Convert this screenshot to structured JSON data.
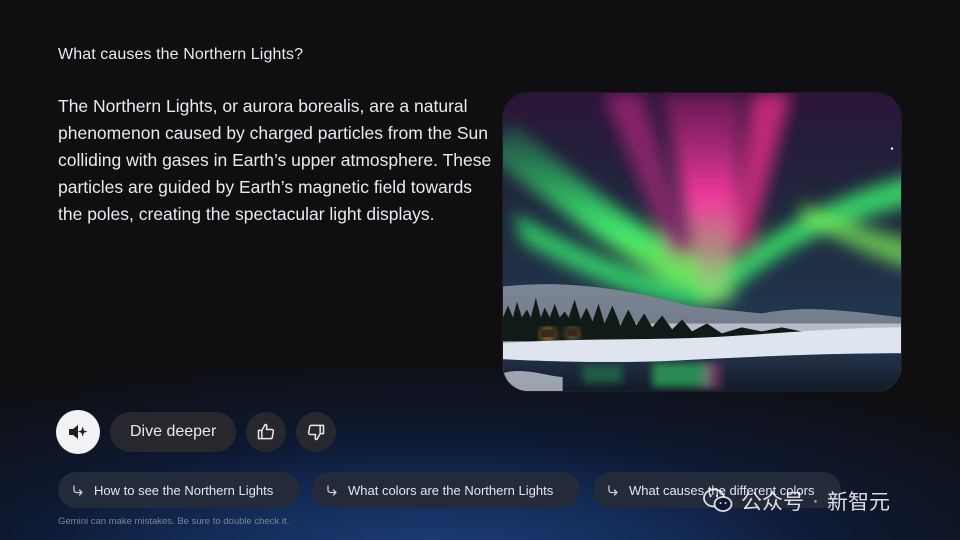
{
  "question": "What causes the Northern Lights?",
  "answer": "The Northern Lights, or aurora borealis, are a natural phenomenon caused by charged particles from the Sun colliding with gases in Earth’s upper atmosphere. These particles are guided by Earth’s magnetic field towards the poles, creating the spectacular light displays.",
  "image": {
    "subject": "aurora borealis over snowy forest and lake"
  },
  "actions": {
    "speak_icon": "speaker-sparkle-icon",
    "dive_deeper": "Dive deeper",
    "thumbs_up_icon": "thumbs-up-icon",
    "thumbs_down_icon": "thumbs-down-icon"
  },
  "suggestions": [
    {
      "icon": "reply-arrow-icon",
      "label": "How to see the Northern Lights"
    },
    {
      "icon": "reply-arrow-icon",
      "label": "What colors are the Northern Lights"
    },
    {
      "icon": "reply-arrow-icon",
      "label": "What causes the different colors"
    }
  ],
  "disclaimer": "Gemini can make mistakes. Be sure to double check it.",
  "watermark": {
    "text": "公众号",
    "separator": "·",
    "brand": "新智元"
  },
  "colors": {
    "background": "#0f0f12",
    "chip": "#232a3a",
    "pill": "#26282d",
    "glow": "#1c3f7a"
  }
}
